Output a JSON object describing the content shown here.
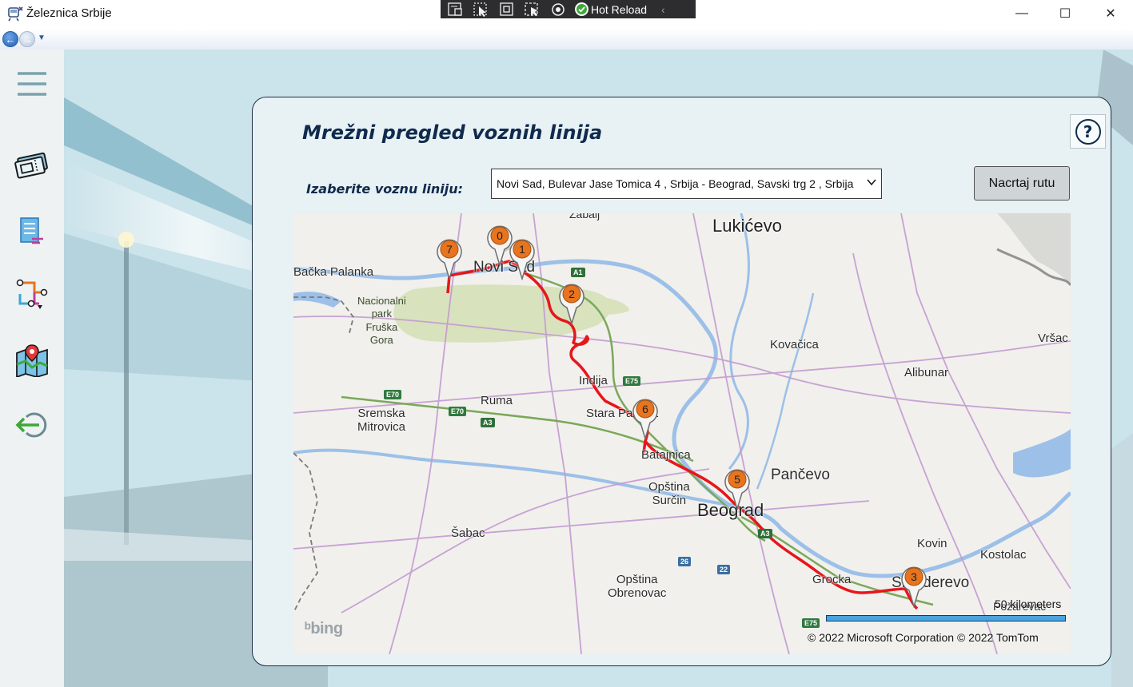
{
  "window": {
    "title": "Železnica Srbije",
    "icon": "app-train-icon",
    "controls": {
      "minimize": "—",
      "maximize": "☐",
      "close": "✕"
    }
  },
  "hot_toolbar": {
    "icons": [
      "live-visual-tree-icon",
      "select-element-icon",
      "display-layout-adorners-icon",
      "track-focus-icon",
      "binding-failures-icon"
    ],
    "hot_reload_label": "Hot Reload"
  },
  "sidebar": {
    "items": [
      {
        "name": "menu",
        "icon": "hamburger-menu-icon"
      },
      {
        "name": "tickets",
        "icon": "ticket-icon"
      },
      {
        "name": "timetable",
        "icon": "timetable-list-icon"
      },
      {
        "name": "routes",
        "icon": "route-network-icon"
      },
      {
        "name": "map",
        "icon": "map-location-icon"
      },
      {
        "name": "logout",
        "icon": "logout-icon"
      }
    ]
  },
  "main": {
    "title": "Mrežni pregled voznih linija",
    "help_label": "?",
    "select_label": "Izaberite voznu liniju:",
    "selected_line": "Novi Sad, Bulevar Jase Tomica 4 , Srbija - Beograd, Savski trg 2 , Srbija",
    "draw_button": "Nacrtaj rutu"
  },
  "map": {
    "places": [
      {
        "text": "Zabalj",
        "cls": "sm"
      },
      {
        "text": "Lukićevo",
        "cls": "big"
      },
      {
        "text": "Bačka Palanka",
        "cls": ""
      },
      {
        "text": "Novi Sad",
        "cls": "med"
      },
      {
        "text": "Kovačica",
        "cls": ""
      },
      {
        "text": "Vršac",
        "cls": ""
      },
      {
        "text": "Alibunar",
        "cls": ""
      },
      {
        "text": "Indija",
        "cls": ""
      },
      {
        "text": "Ruma",
        "cls": ""
      },
      {
        "text": "Sremska\nMitrovica",
        "cls": ""
      },
      {
        "text": "Stara Pazova",
        "cls": ""
      },
      {
        "text": "Batajnica",
        "cls": ""
      },
      {
        "text": "Pančevo",
        "cls": "med"
      },
      {
        "text": "Opština\nSurčin",
        "cls": ""
      },
      {
        "text": "Beograd",
        "cls": "big"
      },
      {
        "text": "Šabac",
        "cls": ""
      },
      {
        "text": "Kovin",
        "cls": ""
      },
      {
        "text": "Kostolac",
        "cls": ""
      },
      {
        "text": "Opština\nObrenovac",
        "cls": ""
      },
      {
        "text": "Grocka",
        "cls": ""
      },
      {
        "text": "Smederevo",
        "cls": "med"
      },
      {
        "text": "Požarevac",
        "cls": "sm"
      }
    ],
    "park_label": "Nacionalni\npark\nFruška\nGora",
    "shields": [
      {
        "text": "A1",
        "kind": "shield-a"
      },
      {
        "text": "E75",
        "kind": "shield-e"
      },
      {
        "text": "E70",
        "kind": "shield-e"
      },
      {
        "text": "E70",
        "kind": "shield-e"
      },
      {
        "text": "A3",
        "kind": "shield-a"
      },
      {
        "text": "A3",
        "kind": "shield-a"
      },
      {
        "text": "26",
        "kind": "shield-n"
      },
      {
        "text": "22",
        "kind": "shield-n"
      },
      {
        "text": "E75",
        "kind": "shield-e"
      }
    ],
    "pins": [
      "0",
      "1",
      "2",
      "3",
      "5",
      "6",
      "7"
    ],
    "scale_label": "50 kilometers",
    "copyright": "© 2022 Microsoft Corporation    © 2022 TomTom",
    "provider_logo": "bing",
    "colors": {
      "route": "#e8151b",
      "pin": "#e8741e",
      "water": "#9cc0e8",
      "park": "#d8e2bd"
    }
  }
}
